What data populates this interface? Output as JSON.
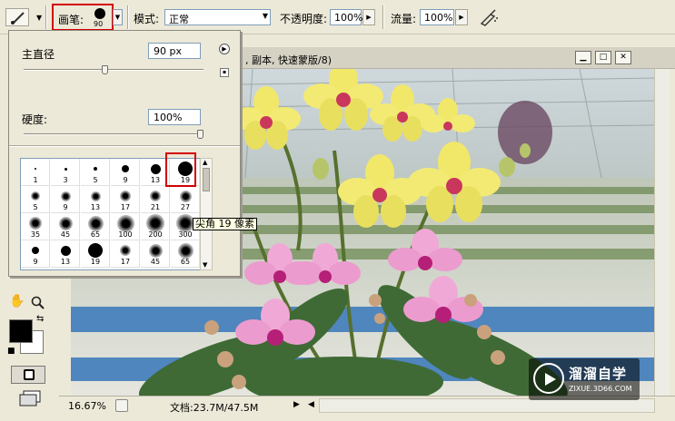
{
  "options_bar": {
    "brush_label": "画笔:",
    "brush_size": "90",
    "mode_label": "模式:",
    "mode_value": "正常",
    "opacity_label": "不透明度:",
    "opacity_value": "100%",
    "flow_label": "流量:",
    "flow_value": "100%"
  },
  "brush_panel": {
    "diameter_label": "主直径",
    "diameter_value": "90 px",
    "diameter_level": 0.45,
    "hardness_label": "硬度:",
    "hardness_value": "100%",
    "hardness_level": 1.0,
    "presets": [
      {
        "size": "1",
        "kind": "hard"
      },
      {
        "size": "3",
        "kind": "hard"
      },
      {
        "size": "5",
        "kind": "hard"
      },
      {
        "size": "9",
        "kind": "hard"
      },
      {
        "size": "13",
        "kind": "hard"
      },
      {
        "size": "19",
        "kind": "hard",
        "selected": true
      },
      {
        "size": "5",
        "kind": "soft"
      },
      {
        "size": "9",
        "kind": "soft"
      },
      {
        "size": "13",
        "kind": "soft"
      },
      {
        "size": "17",
        "kind": "soft"
      },
      {
        "size": "21",
        "kind": "soft"
      },
      {
        "size": "27",
        "kind": "soft"
      },
      {
        "size": "35",
        "kind": "soft"
      },
      {
        "size": "45",
        "kind": "soft"
      },
      {
        "size": "65",
        "kind": "soft"
      },
      {
        "size": "100",
        "kind": "soft"
      },
      {
        "size": "200",
        "kind": "soft"
      },
      {
        "size": "300",
        "kind": "soft"
      },
      {
        "size": "9",
        "kind": "hard"
      },
      {
        "size": "13",
        "kind": "hard"
      },
      {
        "size": "19",
        "kind": "hard"
      },
      {
        "size": "17",
        "kind": "soft"
      },
      {
        "size": "45",
        "kind": "soft"
      },
      {
        "size": "65",
        "kind": "soft"
      }
    ],
    "tooltip": "尖角 19 像素"
  },
  "document": {
    "title": ", 副本, 快速蒙版/8)",
    "zoom": "16.67%",
    "doc_size": "文档:23.7M/47.5M"
  },
  "watermark": {
    "title": "溜溜自学",
    "url": "ZIXUE.3D66.COM"
  },
  "colors": {
    "highlight": "#d40000",
    "foreground": "#000000",
    "background": "#ffffff"
  }
}
